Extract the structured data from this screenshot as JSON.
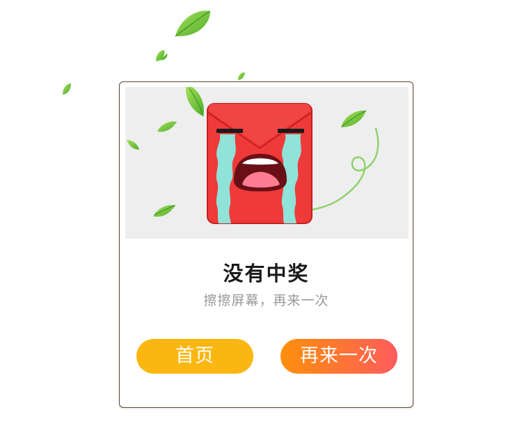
{
  "result": {
    "title": "没有中奖",
    "subtitle": "擦擦屏幕，再来一次"
  },
  "buttons": {
    "home_label": "首页",
    "retry_label": "再来一次"
  },
  "colors": {
    "home_button": "#fbb710",
    "retry_button_start": "#ff8f0b",
    "retry_button_end": "#ff5c5c",
    "envelope_red": "#ef3a3a",
    "tears": "#8fe3d9",
    "leaf_green": "#7ecb3c"
  },
  "icons": {
    "mascot": "crying-red-envelope-icon",
    "decoration": "falling-leaves"
  }
}
